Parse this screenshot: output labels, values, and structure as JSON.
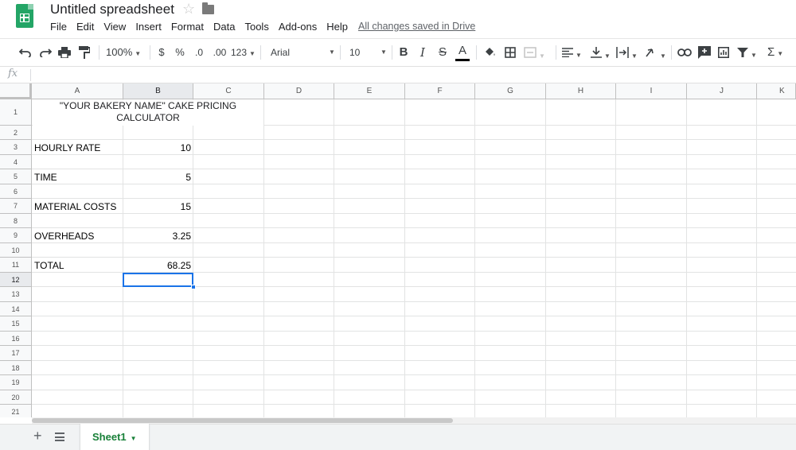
{
  "header": {
    "doc_title": "Untitled spreadsheet",
    "menu": [
      "File",
      "Edit",
      "View",
      "Insert",
      "Format",
      "Data",
      "Tools",
      "Add-ons",
      "Help"
    ],
    "save_status": "All changes saved in Drive",
    "icons": [
      "sheets-logo-icon",
      "star-icon",
      "folder-icon"
    ]
  },
  "toolbar": {
    "zoom": "100%",
    "currency": "$",
    "percent": "%",
    "decrease_decimals": ".0",
    "increase_decimals": ".00",
    "more_formats": "123",
    "font": "Arial",
    "font_size": "10",
    "bold": "B",
    "italic": "I",
    "strikethrough": "S",
    "text_color": "A",
    "sum": "Σ",
    "text_color_hex": "#000000"
  },
  "formula_bar": {
    "fx_label": "fx",
    "value": ""
  },
  "sheet": {
    "columns": [
      "A",
      "B",
      "C",
      "D",
      "E",
      "F",
      "G",
      "H",
      "I",
      "J",
      "K"
    ],
    "rows": [
      "1",
      "2",
      "3",
      "4",
      "5",
      "6",
      "7",
      "8",
      "9",
      "10",
      "11",
      "12",
      "13",
      "14",
      "15",
      "16",
      "17",
      "18",
      "19",
      "20",
      "21"
    ],
    "selected_cell": "B12",
    "title_line1": "\"YOUR BAKERY NAME\" CAKE PRICING",
    "title_line2": "CALCULATOR",
    "entries": [
      {
        "label": "HOURLY RATE",
        "value": "10"
      },
      {
        "label": "TIME",
        "value": "5"
      },
      {
        "label": "MATERIAL COSTS",
        "value": "15"
      },
      {
        "label": "OVERHEADS",
        "value": "3.25"
      },
      {
        "label": "TOTAL",
        "value": "68.25"
      }
    ],
    "accent_color": "#1a73e8"
  },
  "sheet_tabs": {
    "active": "Sheet1",
    "tab_color": "#188038"
  }
}
